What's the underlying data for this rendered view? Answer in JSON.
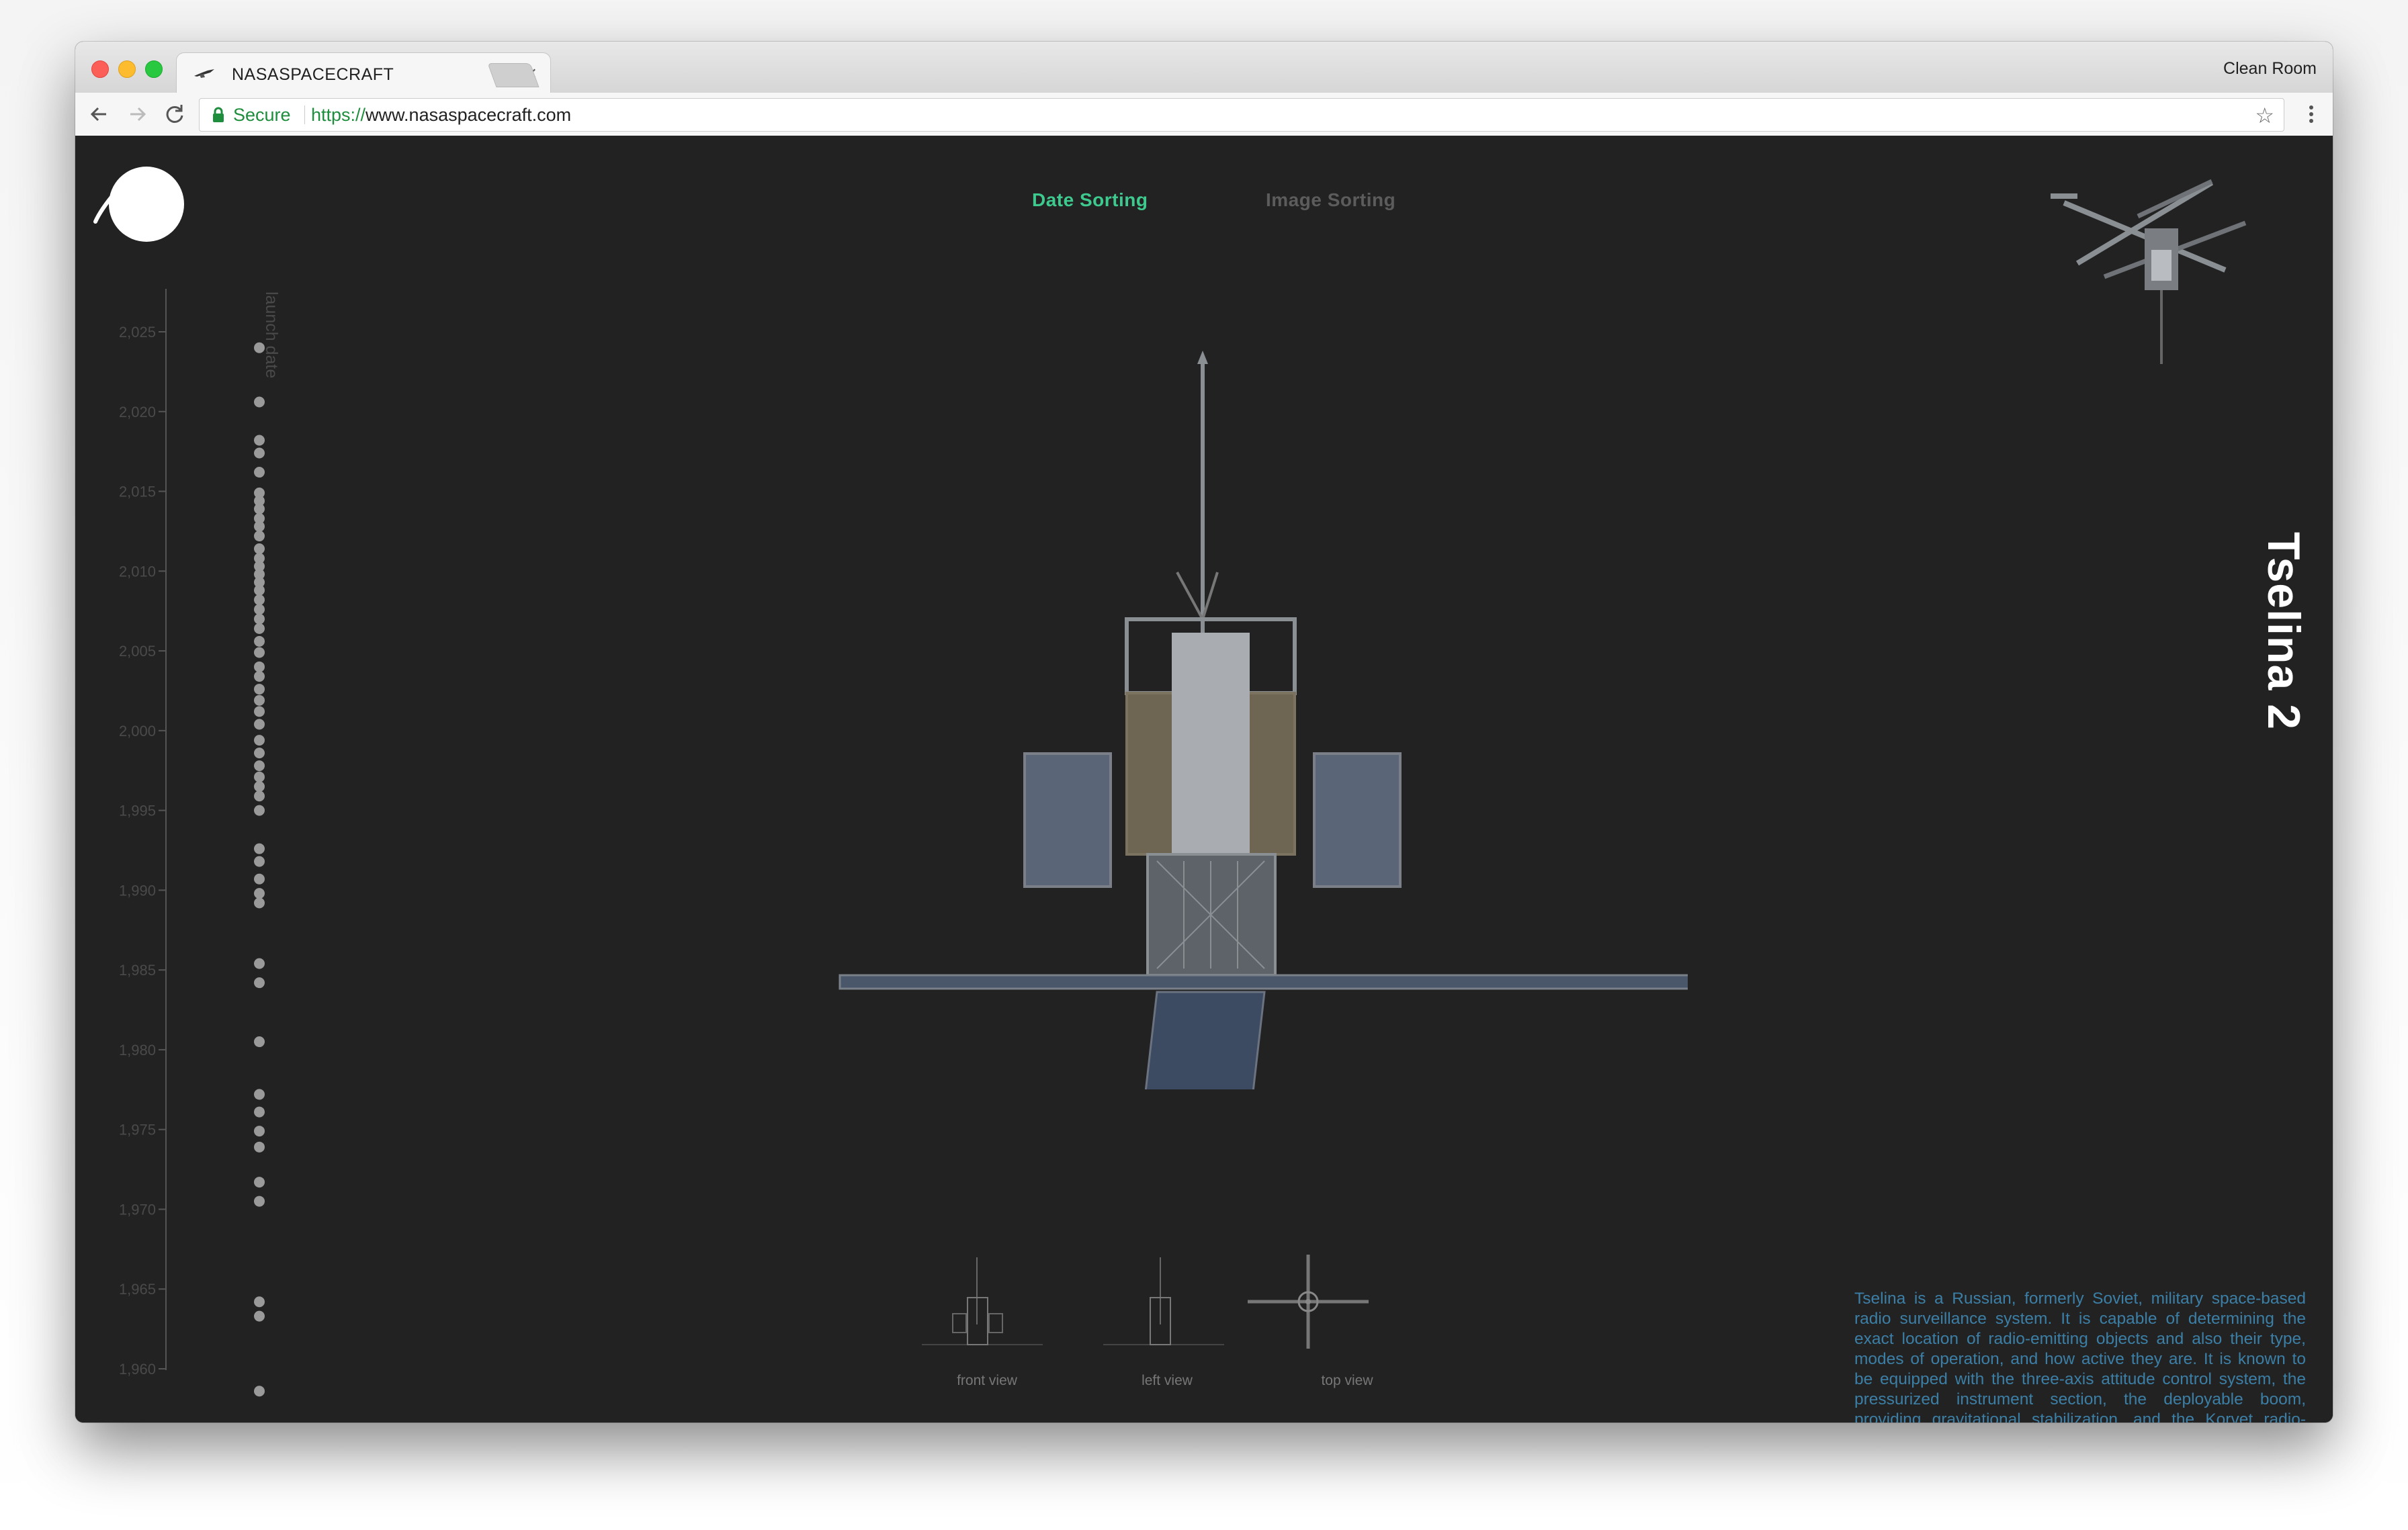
{
  "browser": {
    "tab_title": "NASASPACECRAFT",
    "profile_label": "Clean Room",
    "secure_label": "Secure",
    "url_scheme": "https://",
    "url_host": "www.nasaspacecraft.com"
  },
  "nav": {
    "date_sorting": "Date Sorting",
    "image_sorting": "Image Sorting",
    "active": "Date Sorting",
    "active_color": "#3ec98f"
  },
  "timeline": {
    "axis_label": "launch date",
    "ticks": [
      "2,025",
      "2,020",
      "2,015",
      "2,010",
      "2,005",
      "2,000",
      "1,995",
      "1,990",
      "1,985",
      "1,980",
      "1,975",
      "1,970",
      "1,965",
      "1,960"
    ],
    "tick_values": [
      2025,
      2020,
      2015,
      2010,
      2005,
      2000,
      1995,
      1990,
      1985,
      1980,
      1975,
      1970,
      1965,
      1960
    ],
    "launch_years": [
      2024,
      2020.6,
      2018.2,
      2017.4,
      2016.2,
      2014.9,
      2014.4,
      2013.9,
      2013.3,
      2012.8,
      2012.2,
      2011.4,
      2010.8,
      2010.3,
      2009.8,
      2009.3,
      2008.8,
      2008.2,
      2007.6,
      2007.0,
      2006.4,
      2005.6,
      2004.9,
      2004.0,
      2003.4,
      2002.6,
      2001.9,
      2001.2,
      2000.4,
      1999.4,
      1998.6,
      1997.8,
      1997.1,
      1996.5,
      1995.9,
      1995.0,
      1992.6,
      1991.8,
      1990.7,
      1989.8,
      1989.2,
      1985.4,
      1984.2,
      1980.5,
      1977.2,
      1976.1,
      1974.9,
      1973.9,
      1971.7,
      1970.5,
      1964.2,
      1963.3,
      1958.6
    ],
    "dot_color": "#9a9a9a"
  },
  "spacecraft": {
    "name": "Tselina 2",
    "description": "Tselina is a Russian, formerly Soviet, military space-based radio surveillance system. It is capable of determining the exact location of radio-emitting objects and also their type, modes of operation, and how active they are. It is known to be equipped with the three-axis attitude control system, the pressurized instrument section, the deployable boom, providing gravitational stabilization, and the Korvet radio-receiving hardware."
  },
  "views": [
    {
      "label": "front view"
    },
    {
      "label": "left view"
    },
    {
      "label": "top view"
    }
  ]
}
